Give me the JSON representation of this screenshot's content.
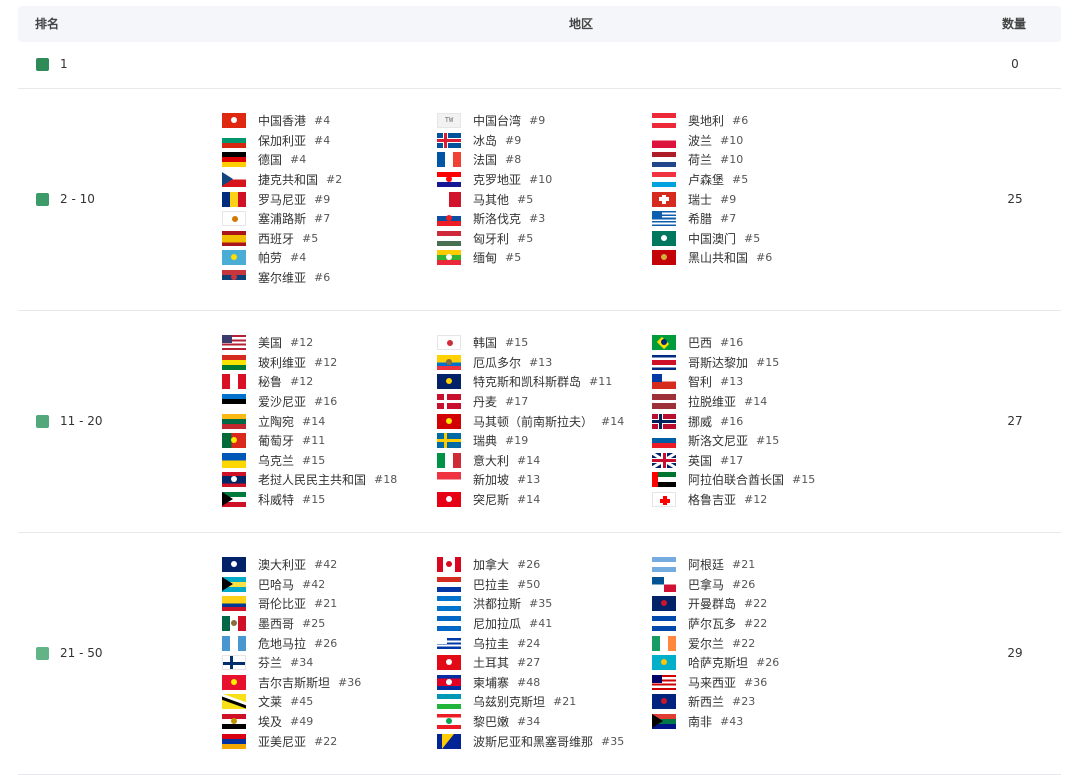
{
  "header": {
    "rank": "排名",
    "region": "地区",
    "count": "数量"
  },
  "rows": [
    {
      "rank": "1",
      "count": "0",
      "color": "#2e8b57",
      "items": []
    },
    {
      "rank": "2 - 10",
      "count": "25",
      "color": "#3d9b6a",
      "items": [
        [
          [
            "中国香港",
            "#4"
          ],
          [
            "保加利亚",
            "#4"
          ],
          [
            "德国",
            "#4"
          ],
          [
            "捷克共和国",
            "#2"
          ],
          [
            "罗马尼亚",
            "#9"
          ],
          [
            "塞浦路斯",
            "#7"
          ],
          [
            "西班牙",
            "#5"
          ],
          [
            "帕劳",
            "#4"
          ],
          [
            "塞尔维亚",
            "#6"
          ]
        ],
        [
          [
            "中国台湾",
            "#9"
          ],
          [
            "冰岛",
            "#9"
          ],
          [
            "法国",
            "#8"
          ],
          [
            "克罗地亚",
            "#10"
          ],
          [
            "马其他",
            "#5"
          ],
          [
            "斯洛伐克",
            "#3"
          ],
          [
            "匈牙利",
            "#5"
          ],
          [
            "缅甸",
            "#5"
          ]
        ],
        [
          [
            "奥地利",
            "#6"
          ],
          [
            "波兰",
            "#10"
          ],
          [
            "荷兰",
            "#10"
          ],
          [
            "卢森堡",
            "#5"
          ],
          [
            "瑞士",
            "#9"
          ],
          [
            "希腊",
            "#7"
          ],
          [
            "中国澳门",
            "#5"
          ],
          [
            "黑山共和国",
            "#6"
          ]
        ]
      ]
    },
    {
      "rank": "11 - 20",
      "count": "27",
      "color": "#52a87a",
      "items": [
        [
          [
            "美国",
            "#12"
          ],
          [
            "玻利维亚",
            "#12"
          ],
          [
            "秘鲁",
            "#12"
          ],
          [
            "爱沙尼亚",
            "#16"
          ],
          [
            "立陶宛",
            "#14"
          ],
          [
            "葡萄牙",
            "#11"
          ],
          [
            "乌克兰",
            "#15"
          ],
          [
            "老挝人民民主共和国",
            "#18"
          ],
          [
            "科威特",
            "#15"
          ]
        ],
        [
          [
            "韩国",
            "#15"
          ],
          [
            "厄瓜多尔",
            "#13"
          ],
          [
            "特克斯和凯科斯群岛",
            "#11"
          ],
          [
            "丹麦",
            "#17"
          ],
          [
            "马其顿（前南斯拉夫）",
            "#14"
          ],
          [
            "瑞典",
            "#19"
          ],
          [
            "意大利",
            "#14"
          ],
          [
            "新加坡",
            "#13"
          ],
          [
            "突尼斯",
            "#14"
          ]
        ],
        [
          [
            "巴西",
            "#16"
          ],
          [
            "哥斯达黎加",
            "#15"
          ],
          [
            "智利",
            "#13"
          ],
          [
            "拉脱维亚",
            "#14"
          ],
          [
            "挪威",
            "#16"
          ],
          [
            "斯洛文尼亚",
            "#15"
          ],
          [
            "英国",
            "#17"
          ],
          [
            "阿拉伯联合酋长国",
            "#15"
          ],
          [
            "格鲁吉亚",
            "#12"
          ]
        ]
      ]
    },
    {
      "rank": "21 - 50",
      "count": "29",
      "color": "#62b386",
      "items": [
        [
          [
            "澳大利亚",
            "#42"
          ],
          [
            "巴哈马",
            "#42"
          ],
          [
            "哥伦比亚",
            "#21"
          ],
          [
            "墨西哥",
            "#25"
          ],
          [
            "危地马拉",
            "#26"
          ],
          [
            "芬兰",
            "#34"
          ],
          [
            "吉尔吉斯斯坦",
            "#36"
          ],
          [
            "文莱",
            "#45"
          ],
          [
            "埃及",
            "#49"
          ],
          [
            "亚美尼亚",
            "#22"
          ]
        ],
        [
          [
            "加拿大",
            "#26"
          ],
          [
            "巴拉圭",
            "#50"
          ],
          [
            "洪都拉斯",
            "#35"
          ],
          [
            "尼加拉瓜",
            "#41"
          ],
          [
            "乌拉圭",
            "#24"
          ],
          [
            "土耳其",
            "#27"
          ],
          [
            "柬埔寨",
            "#48"
          ],
          [
            "乌兹别克斯坦",
            "#21"
          ],
          [
            "黎巴嫩",
            "#34"
          ],
          [
            "波斯尼亚和黑塞哥维那",
            "#35"
          ]
        ],
        [
          [
            "阿根廷",
            "#21"
          ],
          [
            "巴拿马",
            "#26"
          ],
          [
            "开曼群岛",
            "#22"
          ],
          [
            "萨尔瓦多",
            "#22"
          ],
          [
            "爱尔兰",
            "#22"
          ],
          [
            "哈萨克斯坦",
            "#26"
          ],
          [
            "马来西亚",
            "#36"
          ],
          [
            "新西兰",
            "#23"
          ],
          [
            "南非",
            "#43"
          ]
        ]
      ]
    }
  ]
}
